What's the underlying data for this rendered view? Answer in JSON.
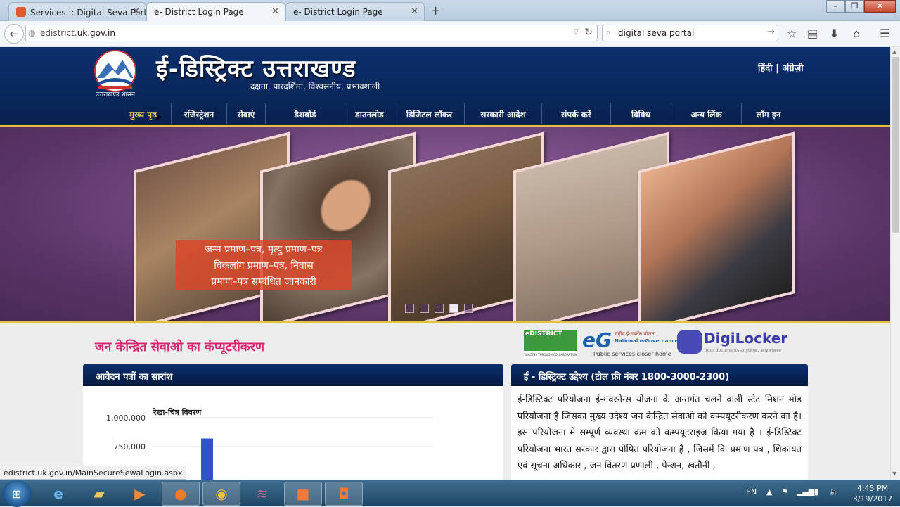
{
  "browser": {
    "tabs": [
      {
        "title": "Services :: Digital Seva Port..."
      },
      {
        "title": "e- District Login Page"
      },
      {
        "title": "e- District Login Page"
      }
    ],
    "url_prefix": "edistrict.",
    "url_host": "uk.gov.in",
    "search_query": "digital seva portal"
  },
  "header": {
    "emblem_caption": "उत्तराखण्ड शासन",
    "title": "ई-डिस्ट्रिक्ट उत्तराखण्ड",
    "tagline": "दक्षता, पारदर्शिता, विश्वसनीय, प्रभावशाली",
    "lang_hindi": "हिंदी",
    "lang_sep": "|",
    "lang_english": "अंग्रेज़ी",
    "nav": [
      {
        "label": "मुख्य पृष्ठ"
      },
      {
        "label": "रजिस्ट्रेशन"
      },
      {
        "label": "सेवाएं"
      },
      {
        "label": "डैशबोर्ड"
      },
      {
        "label": "डाउनलोड"
      },
      {
        "label": "डिजिटल लॉकर"
      },
      {
        "label": "सरकारी आदेश"
      },
      {
        "label": "संपर्क करें"
      },
      {
        "label": "विविध"
      },
      {
        "label": "अन्य लिंक"
      },
      {
        "label": "लॉग इन"
      }
    ]
  },
  "banner": {
    "caption_lines": [
      "जन्म प्रमाण–पत्र, मृत्यु प्रमाण–पत्र",
      "विकलांग प्रमाण–पत्र, निवास",
      "प्रमाण–पत्र सम्बंधित जानकारी"
    ],
    "slide_count": 5,
    "active_slide": 4
  },
  "content": {
    "tagline": "जन केन्द्रित सेवाओ का कंप्यूटरीकरण",
    "logos": {
      "edistrict_name": "eDISTRICT",
      "edistrict_sub": "SUCCESS THROUGH COLLABORATION",
      "negp_line1": "राष्ट्रीय ई-गवर्नेंस योजना",
      "negp_line2": "National e-Governance Plan",
      "negp_line3": "Public services closer home",
      "digilocker_name": "DigiLocker",
      "digilocker_sub": "Your documents anytime, anywhere"
    },
    "left_panel_title": "आवेदन पत्रों का सारांश",
    "right_panel_title": "ई - डिस्ट्रिक्ट उद्देश्य (टोल फ्री नंबर 1800-3000-2300)",
    "description": "ई-डिस्टिक्ट परियोजना ई-गवरनेन्स योजना के अन्तर्गत चलने वाली स्टेट मिशन मोड परियोजना है जिसका मुख्य उदेश्य जन केन्द्रित सेवाओ को कम्पयूटरीकरण करने का है। इस परियोजना में सम्पूर्ण व्यवस्था क्रम को कम्पयूटराइज किया गया है । ई-डिस्टिक्ट परियोजना भारत सरकार द्वारा पोषित परियोजना है , जिसमें कि प्रमाण पत्र , शिकायत एवं सूचना अधिकार , जन वितरण प्रणाली , पेन्शन, खतौनी ,"
  },
  "chart_data": {
    "type": "bar",
    "title": "रेखा-चित्र विवरण",
    "y_ticks": [
      "1,000,000",
      "750,000"
    ],
    "ylim_visible": [
      700000,
      1000000
    ],
    "series": [
      {
        "values": [
          820000
        ]
      }
    ],
    "bar_color": "#2b55c8"
  },
  "status_url": "edistrict.uk.gov.in/MainSecureSewaLogin.aspx",
  "taskbar": {
    "lang": "EN",
    "time": "4:45 PM",
    "date": "3/19/2017"
  }
}
